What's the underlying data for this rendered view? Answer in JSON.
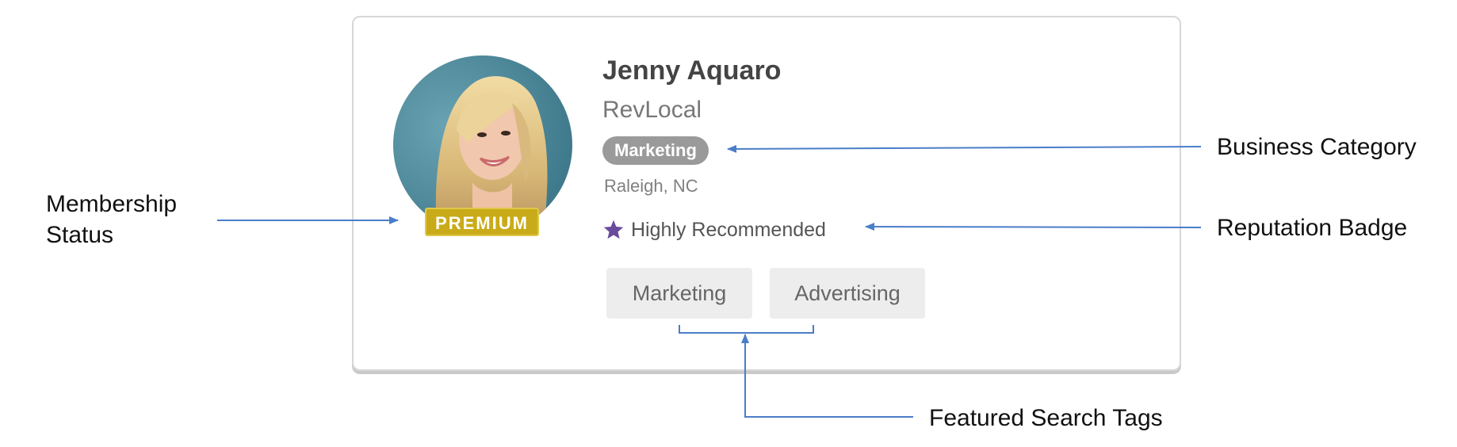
{
  "profile": {
    "name": "Jenny Aquaro",
    "company": "RevLocal",
    "category": "Marketing",
    "location": "Raleigh, NC",
    "membership": "PREMIUM",
    "reputation": "Highly Recommended",
    "tags": [
      "Marketing",
      "Advertising"
    ]
  },
  "annotations": {
    "membership_line1": "Membership",
    "membership_line2": "Status",
    "business_category": "Business Category",
    "reputation_badge": "Reputation Badge",
    "featured_search_tags": "Featured Search Tags"
  },
  "colors": {
    "premium": "#c9ab19",
    "category_pill": "#9a9a9a",
    "star": "#6a4a9c",
    "arrow": "#4a7ec8"
  },
  "icons": {
    "reputation": "star-icon"
  }
}
